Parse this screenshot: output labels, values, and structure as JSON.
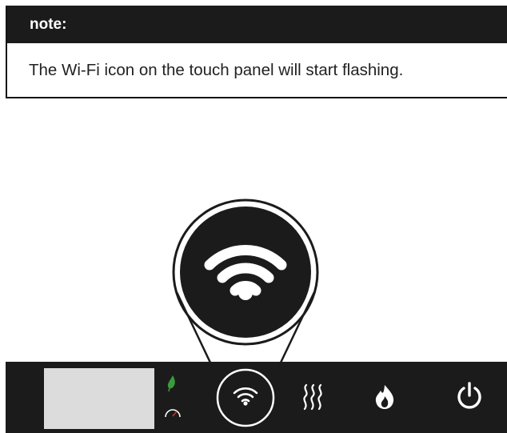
{
  "note": {
    "heading": "note:",
    "text": "The Wi-Fi icon on the touch panel will start flashing."
  },
  "panel": {
    "colors": {
      "panel": "#1b1b1b",
      "display": "#dcdcdc",
      "leaf": "#3a9b3a",
      "gauge_needle": "#c0392b"
    },
    "buttons": [
      {
        "icon": "wifi-icon",
        "state": "flashing"
      },
      {
        "icon": "heat-waves-icon"
      },
      {
        "icon": "flame-icon"
      },
      {
        "icon": "power-icon"
      }
    ],
    "indicators": [
      "leaf-icon",
      "gauge-icon"
    ]
  },
  "magnifier": {
    "icon": "wifi-icon"
  }
}
